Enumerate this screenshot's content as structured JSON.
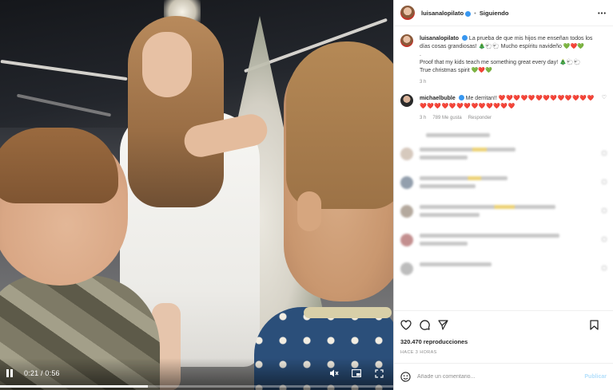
{
  "post": {
    "username": "luisanalopilato",
    "follow_status": "Siguiendo",
    "more": "•••"
  },
  "video": {
    "current_time": "0:21",
    "duration": "0:56",
    "time_display": "0:21 / 0:56",
    "progress_fraction": 0.375
  },
  "caption": {
    "username": "luisanalopilato",
    "text_es": "La prueba de que mis hijos me enseñan todos los días cosas grandiosas! 🎄🐑🐑 Mucho espíritu navideño 💚❤️💚",
    "text_en_dot": ".",
    "text_en": "Proof that my kids teach me something great every day! 🎄🐑🐑",
    "text_en2": "True christmas spirit 💚❤️💚",
    "age": "3 h"
  },
  "top_comment": {
    "username": "michaelbuble",
    "text": "Me derritan!!",
    "hearts": "❤️❤️❤️❤️❤️❤️❤️❤️❤️❤️❤️❤️❤️❤️❤️❤️❤️❤️❤️❤️❤️❤️❤️❤️❤️❤️",
    "age": "3 h",
    "likes": "789 Me gusta",
    "reply": "Responder"
  },
  "stats": {
    "views": "320.470 reproducciones",
    "ago": "HACE 3 HORAS"
  },
  "add_comment": {
    "placeholder": "Añade un comentario...",
    "publish": "Publicar"
  },
  "icons": {
    "like": "heart-icon",
    "comment": "comment-icon",
    "share": "paper-plane-icon",
    "save": "bookmark-icon",
    "emoji": "smiley-icon",
    "pause": "pause-icon",
    "volume": "muted-speaker-icon",
    "pip": "picture-in-picture-icon",
    "fullscreen": "fullscreen-icon"
  },
  "colors": {
    "verified": "#3897f0",
    "hearts": "#e0202e",
    "publish": "#b2dffc"
  }
}
